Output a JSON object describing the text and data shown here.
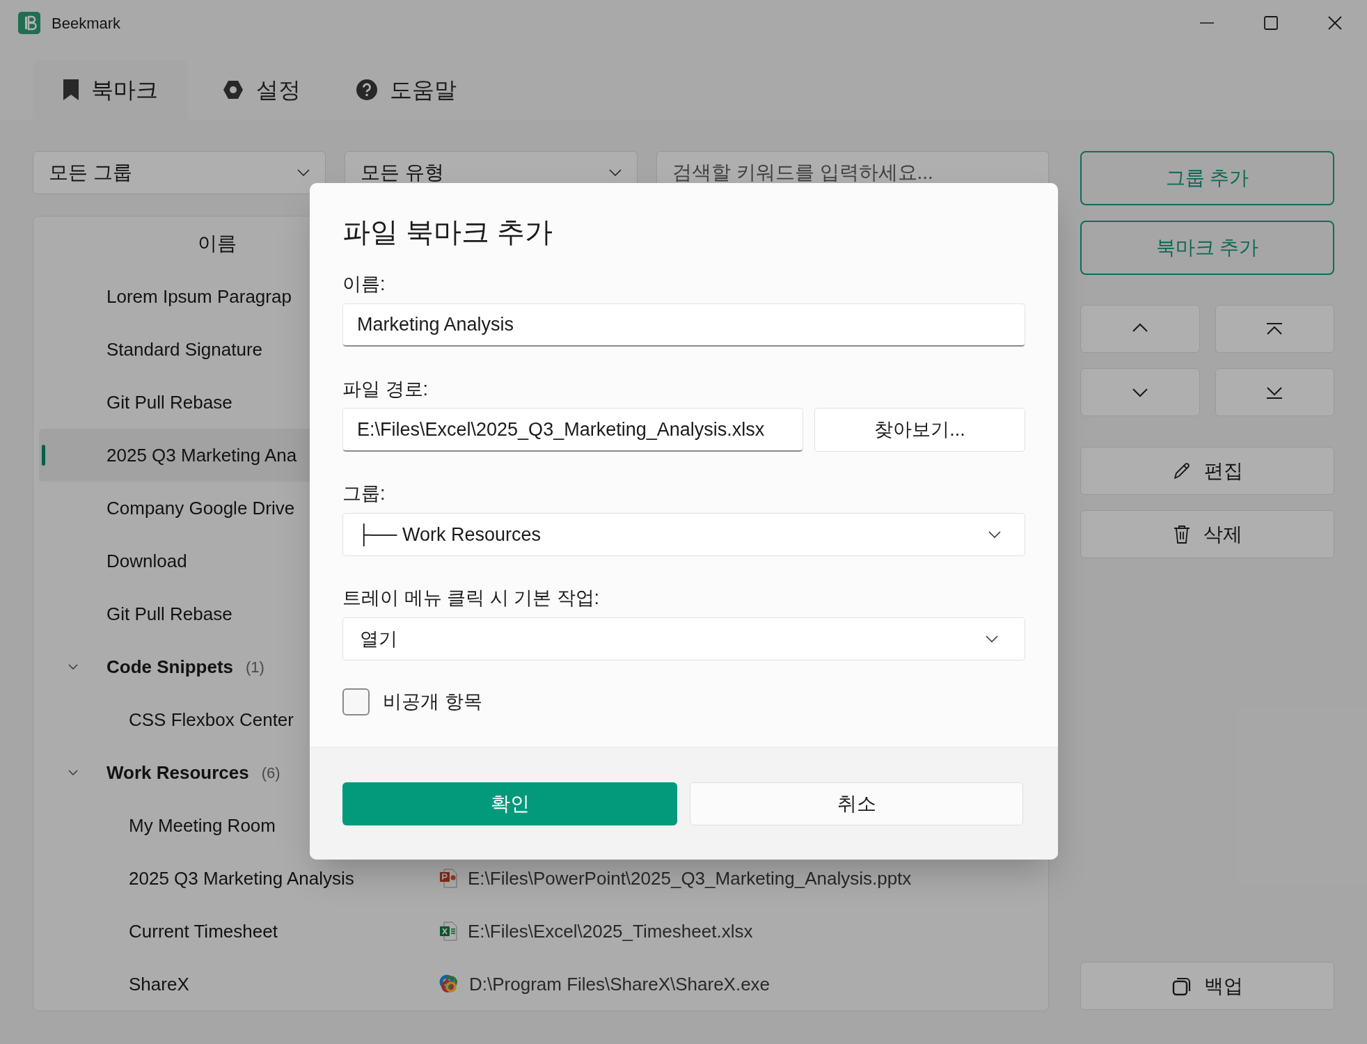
{
  "window": {
    "title": "Beekmark"
  },
  "tabs": [
    {
      "label": "북마크",
      "selected": true
    },
    {
      "label": "설정",
      "selected": false
    },
    {
      "label": "도움말",
      "selected": false
    }
  ],
  "filters": {
    "group": "모든 그룹",
    "type": "모든 유형",
    "search_placeholder": "검색할 키워드를 입력하세요..."
  },
  "list": {
    "columns": [
      "이름"
    ],
    "rows": [
      {
        "name": "Lorem Ipsum Paragrap",
        "selected": false
      },
      {
        "name": "Standard Signature",
        "selected": false
      },
      {
        "name": "Git Pull Rebase",
        "selected": false
      },
      {
        "name": "2025 Q3 Marketing Ana",
        "selected": true
      },
      {
        "name": "Company Google Drive",
        "selected": false
      },
      {
        "name": "Download",
        "selected": false
      },
      {
        "name": "Git Pull Rebase",
        "selected": false
      },
      {
        "kind": "group",
        "name": "Code Snippets",
        "count": "(1)",
        "expanded": true,
        "selected": false,
        "children": [
          {
            "name": "CSS Flexbox Center",
            "selected": false
          }
        ]
      },
      {
        "kind": "group",
        "name": "Work Resources",
        "count": "(6)",
        "expanded": true,
        "selected": false,
        "children": [
          {
            "name": "My Meeting Room",
            "selected": false
          },
          {
            "name": "2025 Q3 Marketing Analysis",
            "selected": false,
            "path": "E:\\Files\\PowerPoint\\2025_Q3_Marketing_Analysis.pptx",
            "kind": "pptx"
          },
          {
            "name": "Current Timesheet",
            "selected": false,
            "path": "E:\\Files\\Excel\\2025_Timesheet.xlsx",
            "kind": "xlsx"
          },
          {
            "name": "ShareX",
            "selected": false,
            "path": "D:\\Program Files\\ShareX\\ShareX.exe",
            "kind": "exe"
          }
        ]
      }
    ]
  },
  "actions": [
    {
      "label": "그룹 추가"
    },
    {
      "label": "북마크 추가"
    }
  ],
  "tools": [
    {
      "label": "편집"
    },
    {
      "label": "삭제"
    }
  ],
  "backup": {
    "label": "백업"
  },
  "dialog": {
    "title": "파일 북마크 추가",
    "name_label": "이름:",
    "name_value": "Marketing Analysis",
    "path_label": "파일 경로:",
    "path_value": "E:\\Files\\Excel\\2025_Q3_Marketing_Analysis.xlsx",
    "browse": "찾아보기...",
    "group_label": "그룹:",
    "group_value": "├── Work Resources",
    "action_label": "트레이 메뉴 클릭 시 기본 작업:",
    "action_value": "열기",
    "private": {
      "label": "비공개 항목",
      "checked": false
    },
    "ok": "확인",
    "cancel": "취소"
  }
}
